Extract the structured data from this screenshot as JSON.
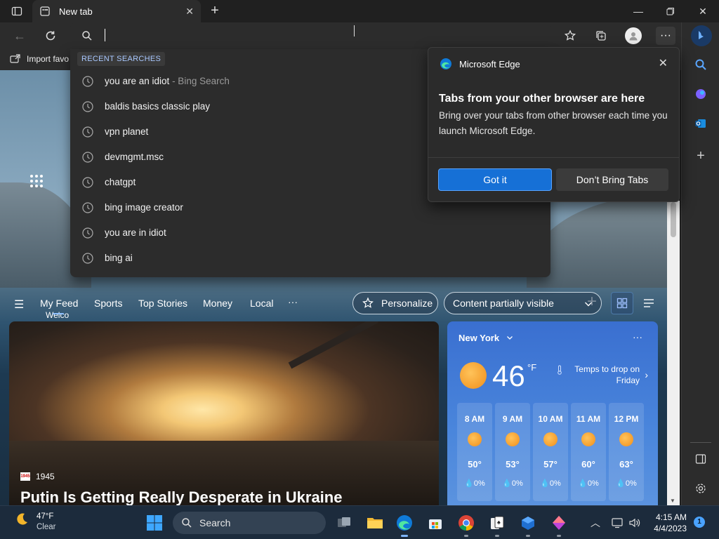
{
  "tab": {
    "title": "New tab"
  },
  "favorites_bar": {
    "import_label": "Import favo"
  },
  "dropdown": {
    "header": "RECENT SEARCHES",
    "items": [
      {
        "text": "you are an idiot",
        "suffix": " - Bing Search"
      },
      {
        "text": "baldis basics classic play",
        "suffix": ""
      },
      {
        "text": "vpn planet",
        "suffix": ""
      },
      {
        "text": "devmgmt.msc",
        "suffix": ""
      },
      {
        "text": "chatgpt",
        "suffix": ""
      },
      {
        "text": "bing image creator",
        "suffix": ""
      },
      {
        "text": "you are in idiot",
        "suffix": ""
      },
      {
        "text": "bing ai",
        "suffix": ""
      }
    ]
  },
  "newtab": {
    "welcome": "Welco"
  },
  "feed_nav": {
    "tabs": [
      "My Feed",
      "Sports",
      "Top Stories",
      "Money",
      "Local",
      "···"
    ],
    "personalize": "Personalize",
    "content_filter": "Content partially visible"
  },
  "news": {
    "source": "1945",
    "source_logo": "1945",
    "headline": "Putin Is Getting Really Desperate in Ukraine"
  },
  "weather": {
    "city": "New York",
    "more": "···",
    "temp": "46",
    "unit": "°F",
    "note": "Temps to drop on Friday",
    "hourly": [
      {
        "time": "8 AM",
        "temp": "50°",
        "precip": "0%"
      },
      {
        "time": "9 AM",
        "temp": "53°",
        "precip": "0%"
      },
      {
        "time": "10 AM",
        "temp": "57°",
        "precip": "0%"
      },
      {
        "time": "11 AM",
        "temp": "60°",
        "precip": "0%"
      },
      {
        "time": "12 PM",
        "temp": "63°",
        "precip": "0%"
      }
    ]
  },
  "popup": {
    "brand": "Microsoft Edge",
    "title": "Tabs from your other browser are here",
    "body": "Bring over your tabs from other browser each time you launch Microsoft Edge.",
    "primary": "Got it",
    "secondary": "Don’t Bring Tabs"
  },
  "taskbar": {
    "weather_temp": "47°F",
    "weather_cond": "Clear",
    "search": "Search",
    "time": "4:15 AM",
    "date": "4/4/2023",
    "notifications": "1"
  },
  "colors": {
    "accent": "#1670d6",
    "weather_card": "#3a6fd0",
    "dropdown_header": "#a9c8ff"
  }
}
